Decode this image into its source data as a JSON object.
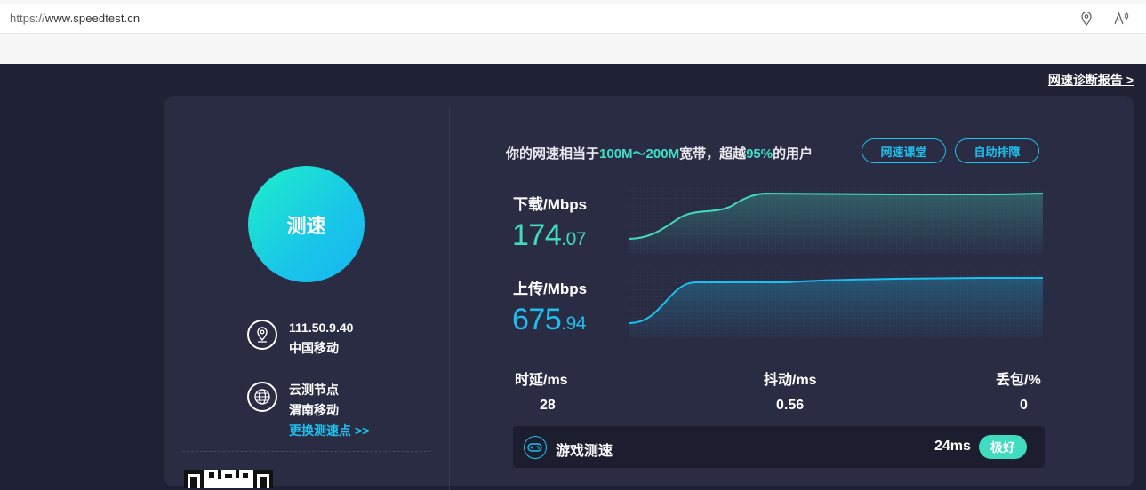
{
  "browser": {
    "url_protocol": "https://",
    "url_host": "www.speedtest.cn"
  },
  "header": {
    "report_link": "网速诊断报告 >"
  },
  "left_panel": {
    "speed_button_label": "测速",
    "ip": "111.50.9.40",
    "isp": "中国移动",
    "node_type": "云测节点",
    "node_name": "渭南移动",
    "change_node_link": "更换测速点 >>"
  },
  "summary": {
    "prefix": "你的网速相当于",
    "band": "100M～200M",
    "middle": "宽带，超越",
    "percent": "95%",
    "suffix": "的用户",
    "course_button": "网速课堂",
    "troubleshoot_button": "自助排障"
  },
  "download": {
    "label": "下载/Mbps",
    "int_part": "174",
    "dec_part": ".07",
    "color": "#41dcc0"
  },
  "upload": {
    "label": "上传/Mbps",
    "int_part": "675",
    "dec_part": ".94",
    "color": "#1bc0ef"
  },
  "stats": {
    "latency_label": "时延/ms",
    "latency_value": "28",
    "jitter_label": "抖动/ms",
    "jitter_value": "0.56",
    "loss_label": "丢包/%",
    "loss_value": "0"
  },
  "game": {
    "icon": "gamepad-icon",
    "label": "游戏测速",
    "latency": "24ms",
    "rating": "极好"
  }
}
